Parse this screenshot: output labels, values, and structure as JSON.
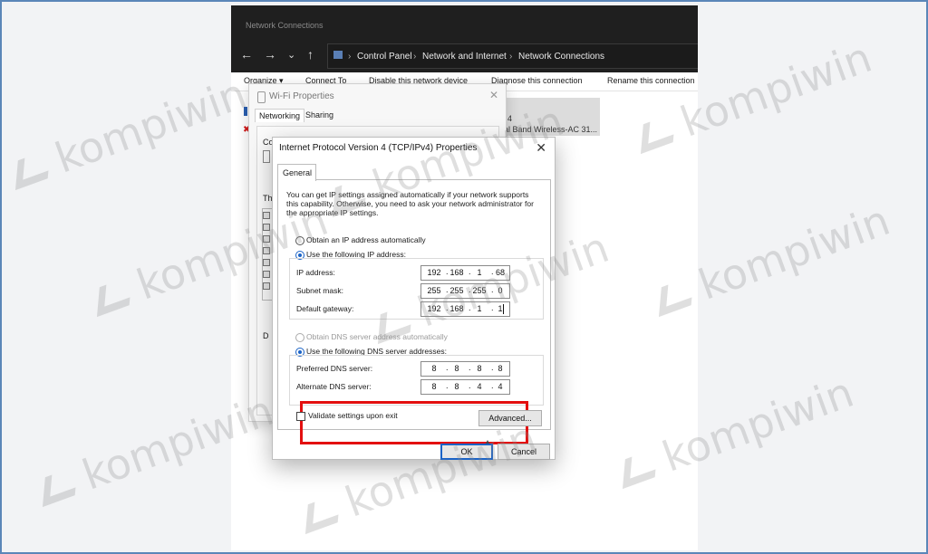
{
  "explorer": {
    "window_title": "Network Connections",
    "breadcrumb": [
      "Control Panel",
      "Network and Internet",
      "Network Connections"
    ],
    "toolbar": [
      "Organize ▾",
      "Connect To",
      "Disable this network device",
      "Diagnose this connection",
      "Rename this connection"
    ],
    "adapter_lines": [
      "4",
      "al Band Wireless-AC 31..."
    ]
  },
  "wifi_properties": {
    "title": "Wi-Fi Properties",
    "tabs": [
      "Networking",
      "Sharing"
    ],
    "partial_labels": [
      "Co",
      "Th",
      "D"
    ]
  },
  "ipv4_dialog": {
    "title": "Internet Protocol Version 4 (TCP/IPv4) Properties",
    "tab": "General",
    "intro": "You can get IP settings assigned automatically if your network supports this capability. Otherwise, you need to ask your network administrator for the appropriate IP settings.",
    "ip_auto_label": "Obtain an IP address automatically",
    "ip_manual_label": "Use the following IP address:",
    "ip_address_label": "IP address:",
    "ip_address": [
      "192",
      "168",
      "1",
      "68"
    ],
    "subnet_label": "Subnet mask:",
    "subnet": [
      "255",
      "255",
      "255",
      "0"
    ],
    "gateway_label": "Default gateway:",
    "gateway": [
      "192",
      "168",
      "1",
      "1"
    ],
    "dns_auto_label": "Obtain DNS server address automatically",
    "dns_manual_label": "Use the following DNS server addresses:",
    "preferred_dns_label": "Preferred DNS server:",
    "preferred_dns": [
      "8",
      "8",
      "8",
      "8"
    ],
    "alternate_dns_label": "Alternate DNS server:",
    "alternate_dns": [
      "8",
      "8",
      "4",
      "4"
    ],
    "validate_label": "Validate settings upon exit",
    "advanced_label": "Advanced...",
    "ok_label": "OK",
    "cancel_label": "Cancel"
  },
  "watermark": "kompiwin",
  "colors": {
    "highlight": "#e31010",
    "accent": "#1b63c6",
    "frame": "#5b86b8"
  }
}
